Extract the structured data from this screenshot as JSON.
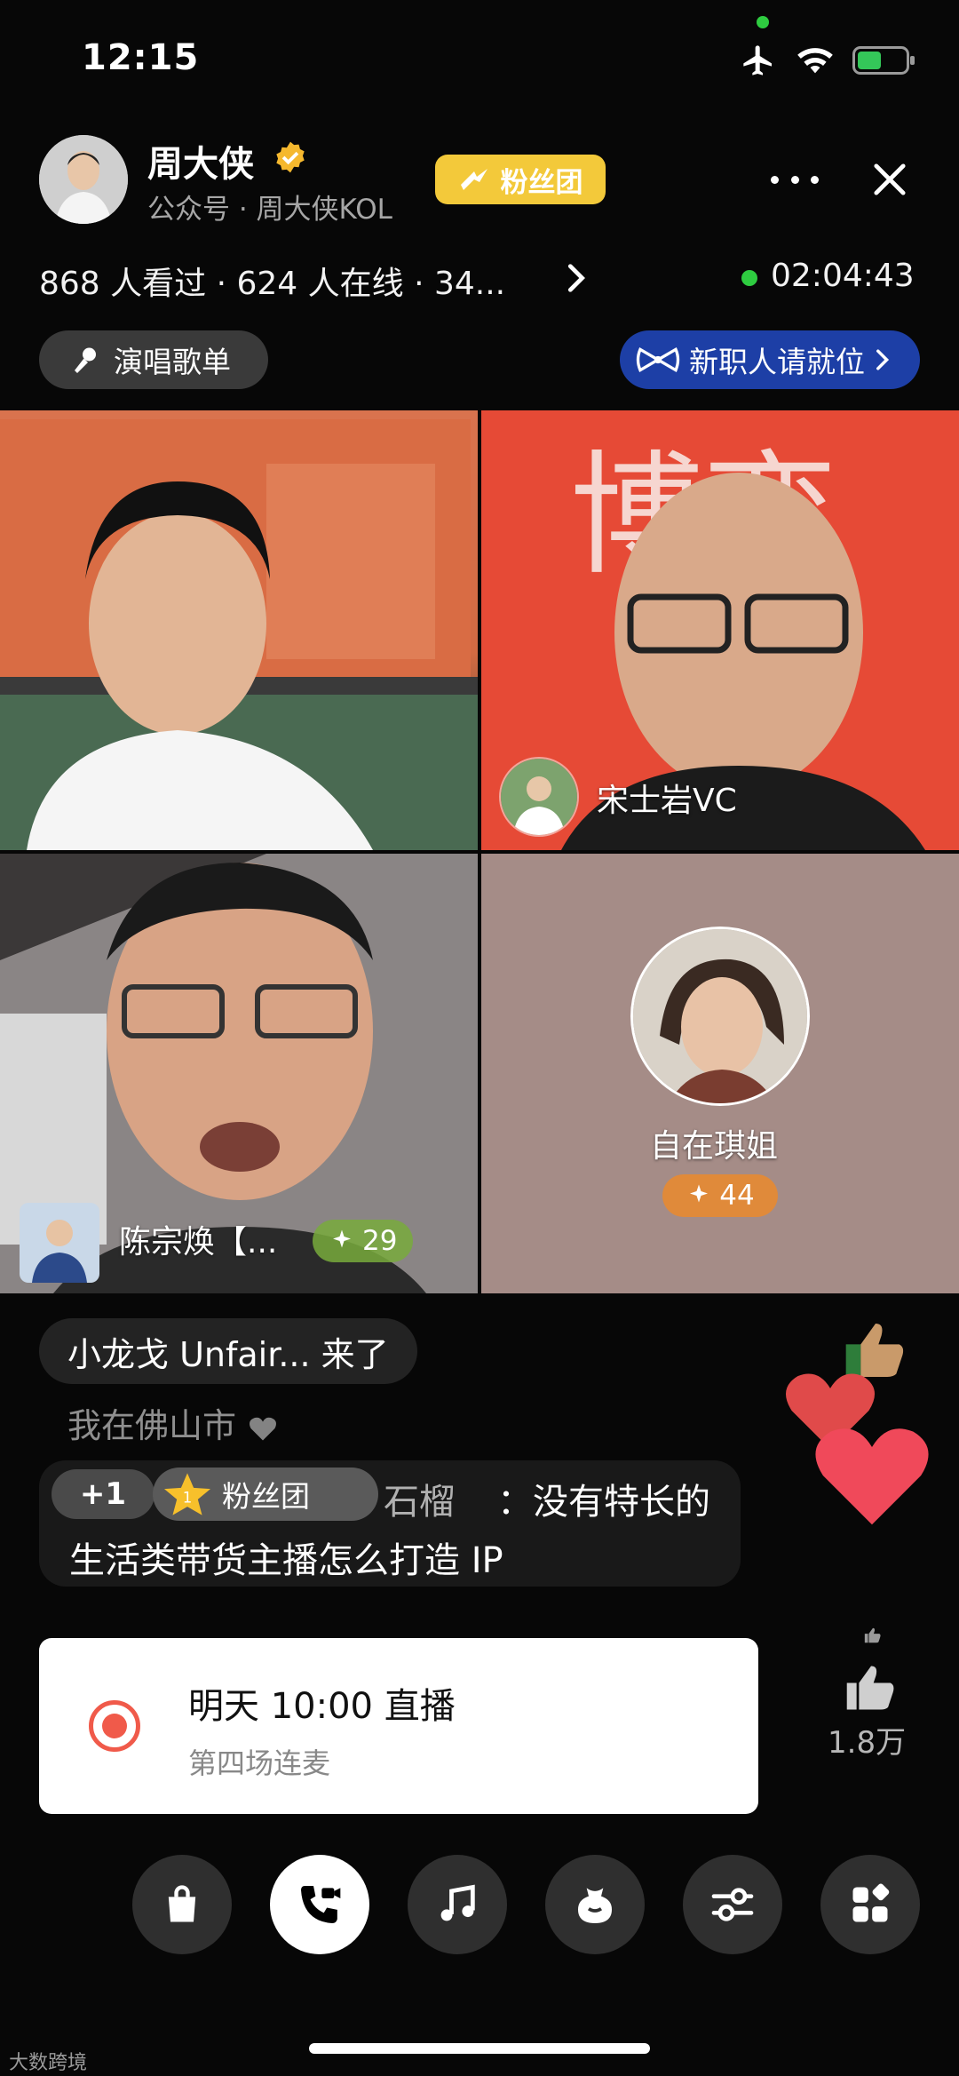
{
  "status": {
    "time": "12:15"
  },
  "header": {
    "host_name": "周大侠",
    "host_sub": "公众号 · 周大侠KOL",
    "fan_club": "粉丝团",
    "viewers": "868 人看过 · 624 人在线 · 34...",
    "live_timer": "02:04:43",
    "song_pill": "演唱歌单",
    "job_pill": "新职人请就位"
  },
  "tiles": {
    "t2_name": "宋士岩VC",
    "t3_name": "陈宗焕【...",
    "t3_count": "29",
    "t4_name": "自在琪姐",
    "t4_count": "44"
  },
  "chat": {
    "join": "小龙戈 Unfair... 来了",
    "fade": "我在佛山市",
    "plus_one": "+1",
    "fan_level": "1",
    "fan_tag": "粉丝团",
    "user": "石榴",
    "text_line1": "：没有特长的",
    "text_line2": "生活类带货主播怎么打造 IP"
  },
  "reserve": {
    "title": "明天 10:00 直播",
    "subtitle": "第四场连麦"
  },
  "likes": {
    "count": "1.8万"
  },
  "toolbar": [
    "shopping-bag-icon",
    "video-call-icon",
    "music-icon",
    "gift-bag-icon",
    "settings-sliders-icon",
    "apps-grid-icon"
  ],
  "watermark": "大数跨境",
  "colors": {
    "fan": "#f3c93a",
    "job": "#1d3fa6",
    "live": "#2ecc40",
    "reserve": "#f05a4a"
  }
}
